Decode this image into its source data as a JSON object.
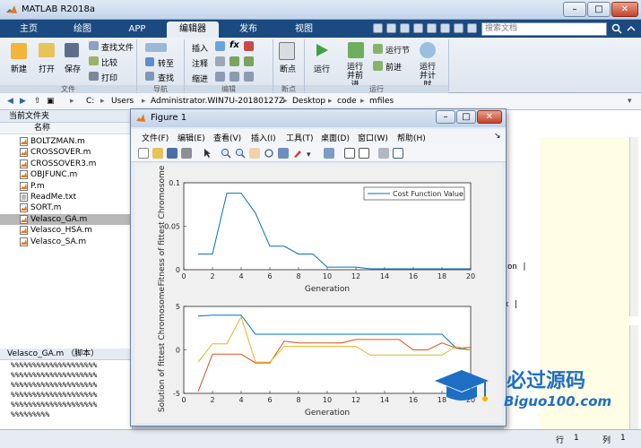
{
  "window": {
    "title": "MATLAB R2018a"
  },
  "tabs": [
    "主页",
    "绘图",
    "APP",
    "编辑器",
    "发布",
    "视图"
  ],
  "search_placeholder": "搜索文档",
  "ribbon": {
    "file": {
      "new": "新建",
      "open": "打开",
      "save": "保存",
      "find_files": "查找文件",
      "compare": "比较",
      "print": "打印",
      "group": "文件"
    },
    "navigate": {
      "goto": "转至",
      "find": "查找",
      "group": "导航"
    },
    "edit": {
      "insert": "插入",
      "comment": "注释",
      "indent": "缩进",
      "fx": "fx",
      "group": "编辑"
    },
    "breakpoints": {
      "label": "断点",
      "group": "断点"
    },
    "run": {
      "run": "运行",
      "run_advance": "运行并前进",
      "run_section": "运行节",
      "advance": "前进",
      "run_time": "运行并计时",
      "group": "运行"
    }
  },
  "address": [
    "C:",
    "Users",
    "Administrator.WIN7U-20180127Z",
    "Desktop",
    "code",
    "mfiles"
  ],
  "file_panel": {
    "title": "当前文件夹",
    "column": "名称",
    "files": [
      {
        "name": "BOLTZMAN.m",
        "selected": false
      },
      {
        "name": "CROSSOVER.m",
        "selected": false
      },
      {
        "name": "CROSSOVER3.m",
        "selected": false
      },
      {
        "name": "OBJFUNC.m",
        "selected": false
      },
      {
        "name": "P.m",
        "selected": false
      },
      {
        "name": "ReadMe.txt",
        "selected": false
      },
      {
        "name": "SORT.m",
        "selected": false
      },
      {
        "name": "Velasco_GA.m",
        "selected": true
      },
      {
        "name": "Velasco_HSA.m",
        "selected": false
      },
      {
        "name": "Velasco_SA.m",
        "selected": false
      }
    ]
  },
  "details_panel": {
    "title": "Velasco_GA.m （脚本）",
    "lines": [
      "%%%%%%%%%%%%%%%%%%%%",
      "%%%%%%%%%%%%%%%%%%%%",
      "%%%%%%%%%%%%%%%%%%%%",
      "%%%%%%%%%%%%%%%%%%%%",
      "%%%%%%%%%%%%%%%%%%%%",
      "%%%%%%%%%"
    ]
  },
  "editor_fragments": {
    "frag1": "on |",
    "frag2": "x |"
  },
  "status": {
    "line_label": "行",
    "line": "1",
    "col_label": "列",
    "col": "1"
  },
  "figure": {
    "title": "Figure 1",
    "menus": [
      "文件(F)",
      "编辑(E)",
      "查看(V)",
      "插入(I)",
      "工具(T)",
      "桌面(D)",
      "窗口(W)",
      "帮助(H)"
    ]
  },
  "chart_data": [
    {
      "type": "line",
      "xlabel": "Generation",
      "ylabel": "Fitness of fittest Chromosome",
      "xlim": [
        0,
        20
      ],
      "ylim": [
        0,
        0.1
      ],
      "xticks": [
        0,
        2,
        4,
        6,
        8,
        10,
        12,
        14,
        16,
        18,
        20
      ],
      "yticks": [
        0,
        0.05,
        0.1
      ],
      "ytick_labels": [
        "0",
        "0.05",
        "0.1"
      ],
      "legend_position": "top-right",
      "series": [
        {
          "name": "Cost Function Value",
          "color": "#0072bd",
          "x": [
            1,
            2,
            3,
            4,
            5,
            6,
            7,
            8,
            9,
            10,
            11,
            12,
            13,
            14,
            15,
            16,
            17,
            18,
            19,
            20
          ],
          "y": [
            0.018,
            0.018,
            0.088,
            0.088,
            0.065,
            0.027,
            0.027,
            0.018,
            0.018,
            0.003,
            0.003,
            0.003,
            0.001,
            0.001,
            0.001,
            0.001,
            0.001,
            0.001,
            0.001,
            0.001
          ]
        }
      ]
    },
    {
      "type": "line",
      "xlabel": "Generation",
      "ylabel": "Solution of fittest Chromosome",
      "xlim": [
        0,
        20
      ],
      "ylim": [
        -5,
        5
      ],
      "xticks": [
        0,
        2,
        4,
        6,
        8,
        10,
        12,
        14,
        16,
        18,
        20
      ],
      "yticks": [
        -5,
        0,
        5
      ],
      "ytick_labels": [
        "-5",
        "0",
        "5"
      ],
      "series": [
        {
          "color": "#0072bd",
          "x": [
            1,
            2,
            3,
            4,
            5,
            6,
            7,
            8,
            9,
            10,
            11,
            12,
            13,
            14,
            15,
            16,
            17,
            18,
            19,
            20
          ],
          "y": [
            3.9,
            4.0,
            4.0,
            4.0,
            1.8,
            1.8,
            1.8,
            1.8,
            1.8,
            1.8,
            1.8,
            1.8,
            1.8,
            1.8,
            1.8,
            1.8,
            1.8,
            1.8,
            0.2,
            0.0
          ]
        },
        {
          "color": "#d95319",
          "x": [
            1,
            2,
            3,
            4,
            5,
            6,
            7,
            8,
            9,
            10,
            11,
            12,
            13,
            14,
            15,
            16,
            17,
            18,
            19,
            20
          ],
          "y": [
            -4.8,
            -0.5,
            -0.5,
            -0.5,
            -1.5,
            -1.5,
            1.0,
            0.8,
            0.8,
            0.8,
            0.8,
            1.2,
            1.2,
            1.2,
            1.2,
            0.0,
            0.0,
            0.8,
            0.2,
            0.3
          ]
        },
        {
          "color": "#edb120",
          "x": [
            1,
            2,
            3,
            4,
            5,
            6,
            7,
            8,
            9,
            10,
            11,
            12,
            13,
            14,
            15,
            16,
            17,
            18,
            19,
            20
          ],
          "y": [
            -1.4,
            0.7,
            0.7,
            3.8,
            -1.4,
            -1.4,
            0.4,
            0.4,
            0.4,
            0.4,
            0.4,
            0.4,
            -0.6,
            -0.6,
            -0.6,
            -0.6,
            -0.6,
            -0.6,
            0.4,
            0.0
          ]
        }
      ]
    }
  ],
  "watermark": {
    "brand": "必过源码",
    "url": "Biguo100.com"
  }
}
